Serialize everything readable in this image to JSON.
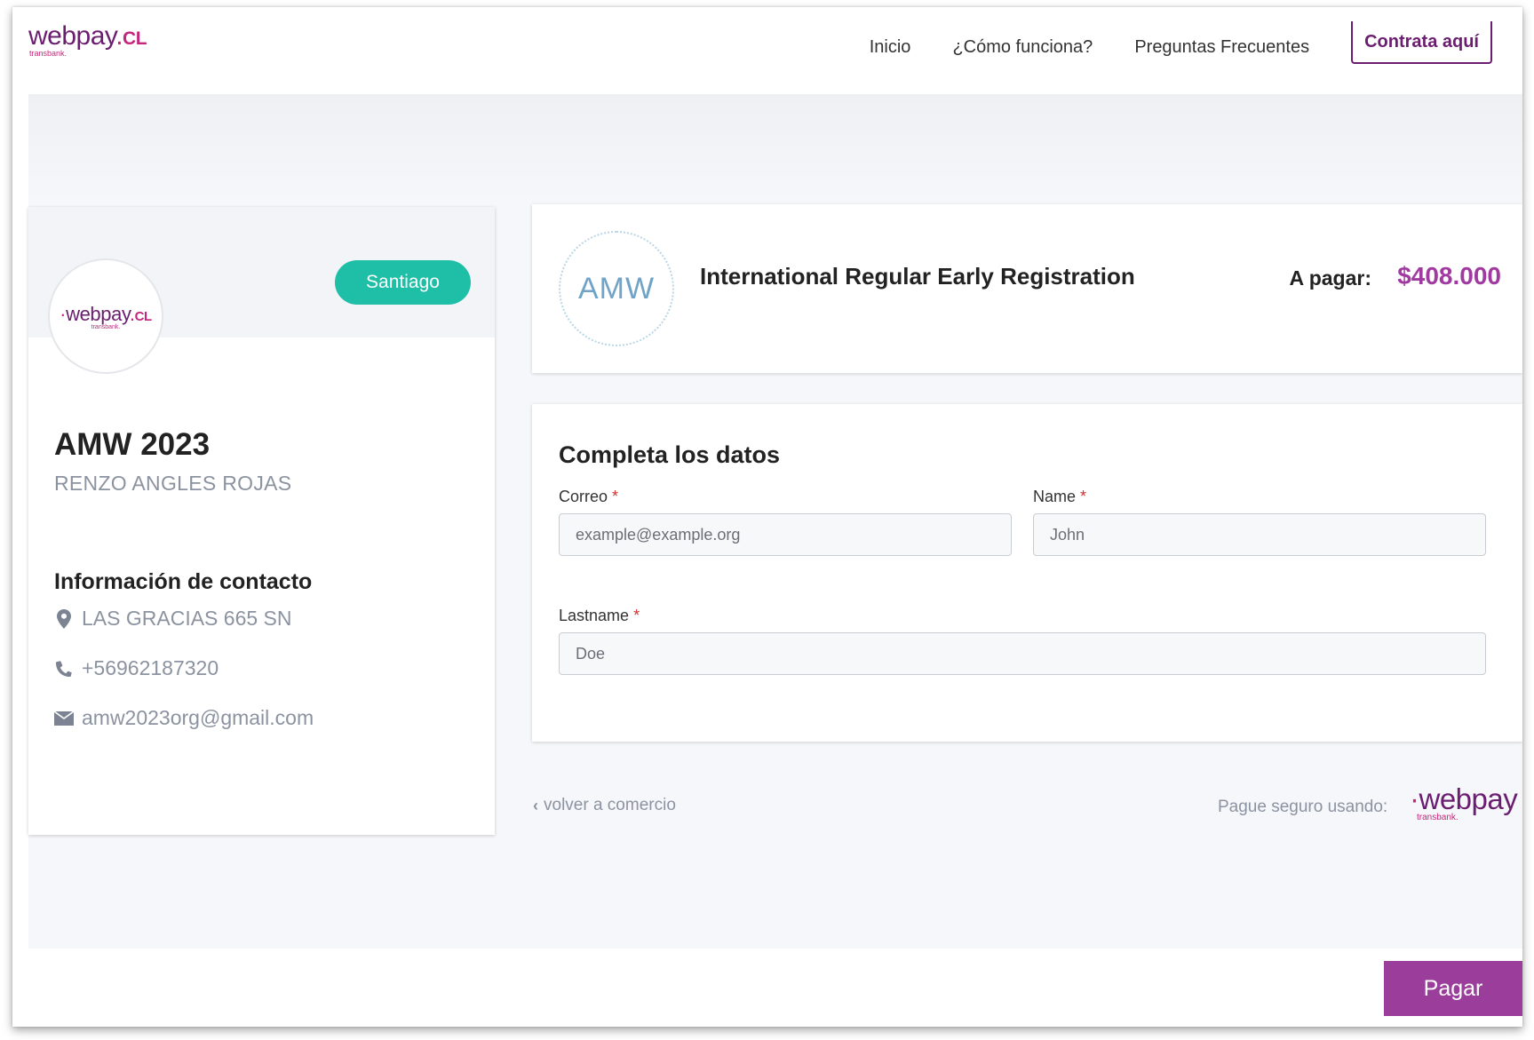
{
  "header": {
    "logo_text": "webpay",
    "logo_dot": ".",
    "logo_suffix": "CL",
    "logo_sub": "transbank.",
    "nav": [
      {
        "label": "Inicio"
      },
      {
        "label": "¿Cómo funciona?"
      },
      {
        "label": "Preguntas Frecuentes"
      }
    ],
    "cta_label": "Contrata aquí"
  },
  "merchant": {
    "avatar_logo_text": "webpay",
    "avatar_logo_dot": ".",
    "avatar_logo_suffix": "CL",
    "avatar_logo_sub": "transbank.",
    "city": "Santiago",
    "name": "AMW 2023",
    "owner": "RENZO ANGLES ROJAS",
    "contact_title": "Información de contacto",
    "address": "LAS GRACIAS 665 SN",
    "phone": "+56962187320",
    "email": "amw2023org@gmail.com"
  },
  "product": {
    "avatar_text": "AMW",
    "title": "International Regular Early Registration",
    "amount_label": "A pagar:",
    "amount_value": "$408.000"
  },
  "form": {
    "title": "Completa los datos",
    "required_mark": "*",
    "email_label": "Correo",
    "email_placeholder": "example@example.org",
    "name_label": "Name",
    "name_placeholder": "John",
    "lastname_label": "Lastname",
    "lastname_placeholder": "Doe"
  },
  "footer": {
    "back_link": "volver a comercio",
    "secure_text": "Pague seguro usando:",
    "secure_logo_text": "webpay",
    "secure_logo_sub": "transbank.",
    "pay_button": "Pagar"
  },
  "colors": {
    "brand": "#6b1e6f",
    "accent": "#c4267c",
    "badge": "#1fbfa7",
    "amount": "#a03aa0",
    "pay_button": "#9b3d9b"
  }
}
